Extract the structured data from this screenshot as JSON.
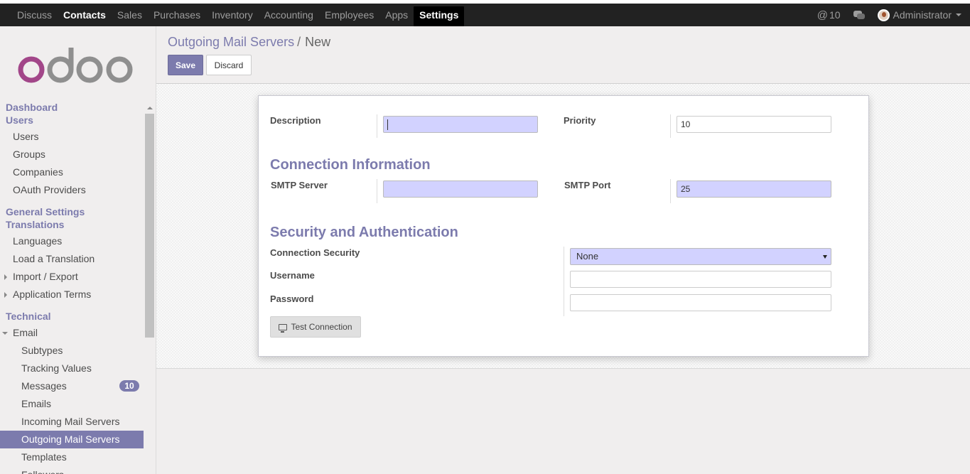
{
  "topbar": {
    "menu": [
      "Discuss",
      "Contacts",
      "Sales",
      "Purchases",
      "Inventory",
      "Accounting",
      "Employees",
      "Apps",
      "Settings"
    ],
    "mentions_count": "10",
    "user_name": "Administrator"
  },
  "sidebar": {
    "brand": "odoo",
    "sections": {
      "dashboard": "Dashboard",
      "users": "Users",
      "general_settings": "General Settings",
      "translations": "Translations",
      "technical": "Technical"
    },
    "items": {
      "users": "Users",
      "groups": "Groups",
      "companies": "Companies",
      "oauth": "OAuth Providers",
      "languages": "Languages",
      "load_translation": "Load a Translation",
      "import_export": "Import / Export",
      "app_terms": "Application Terms",
      "email": "Email",
      "subtypes": "Subtypes",
      "tracking_values": "Tracking Values",
      "messages": "Messages",
      "messages_badge": "10",
      "emails": "Emails",
      "incoming": "Incoming Mail Servers",
      "outgoing": "Outgoing Mail Servers",
      "templates": "Templates",
      "followers": "Followers"
    }
  },
  "breadcrumb": {
    "parent": "Outgoing Mail Servers",
    "separator": "/",
    "current": "New"
  },
  "buttons": {
    "save": "Save",
    "discard": "Discard",
    "test_connection": "Test Connection"
  },
  "form": {
    "description_label": "Description",
    "description_value": "",
    "priority_label": "Priority",
    "priority_value": "10",
    "connection_title": "Connection Information",
    "smtp_server_label": "SMTP Server",
    "smtp_server_value": "",
    "smtp_port_label": "SMTP Port",
    "smtp_port_value": "25",
    "security_title": "Security and Authentication",
    "connection_security_label": "Connection Security",
    "connection_security_value": "None",
    "username_label": "Username",
    "username_value": "",
    "password_label": "Password",
    "password_value": ""
  },
  "colors": {
    "accent": "#7c7bad",
    "required_field": "#d2d2ff",
    "navbar": "#222222"
  }
}
